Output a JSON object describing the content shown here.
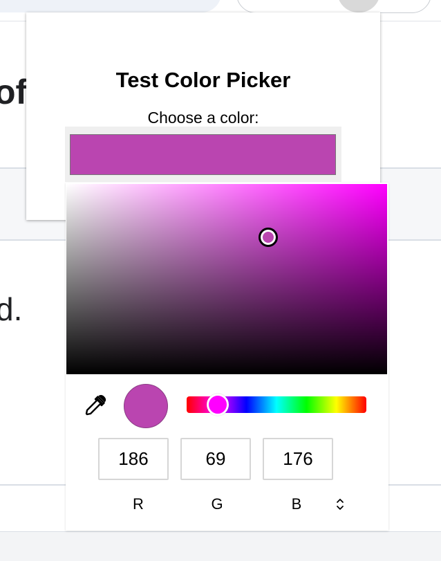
{
  "background": {
    "heading_fragment": "of",
    "text_fragment": "d."
  },
  "card": {
    "title": "Test Color Picker",
    "label": "Choose a color:",
    "selected_color": "#ba45b0"
  },
  "picker": {
    "hue_color": "#ff00ff",
    "hue_fraction": 0.16,
    "saturation": 0.63,
    "value": 0.73,
    "preview_color": "#ba45b0",
    "eyedropper_icon": "eyedropper-icon",
    "format_toggle_icon": "up-down-chevron-icon",
    "channels": [
      {
        "label": "R",
        "value": "186"
      },
      {
        "label": "G",
        "value": "69"
      },
      {
        "label": "B",
        "value": "176"
      }
    ]
  }
}
